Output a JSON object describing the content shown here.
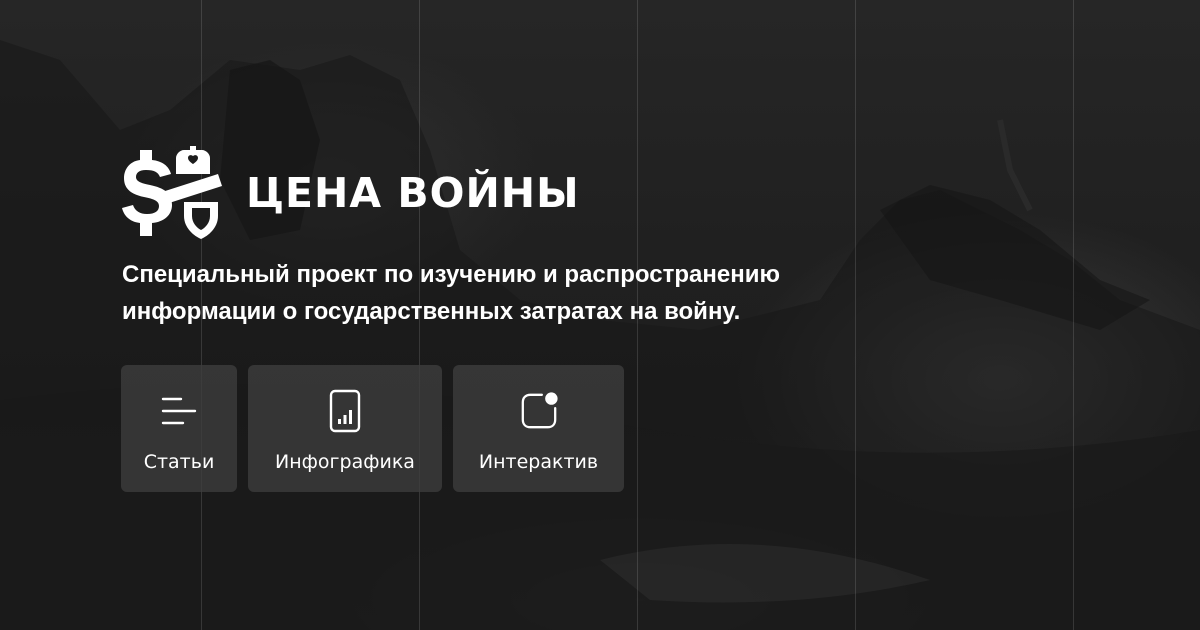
{
  "brand": {
    "name": "ЦЕНА ВОЙНЫ"
  },
  "subtitle": {
    "line1": "Специальный проект по изучению и распространению",
    "line2": "информации о государственных затратах на войну."
  },
  "nav": {
    "items": [
      {
        "label": "Статьи",
        "icon": "menu-lines-icon"
      },
      {
        "label": "Инфографика",
        "icon": "bar-chart-icon"
      },
      {
        "label": "Интерактив",
        "icon": "notification-square-icon"
      }
    ]
  },
  "colors": {
    "background": "#1c1c1c",
    "card": "#3e3e3e",
    "text": "#ffffff"
  }
}
